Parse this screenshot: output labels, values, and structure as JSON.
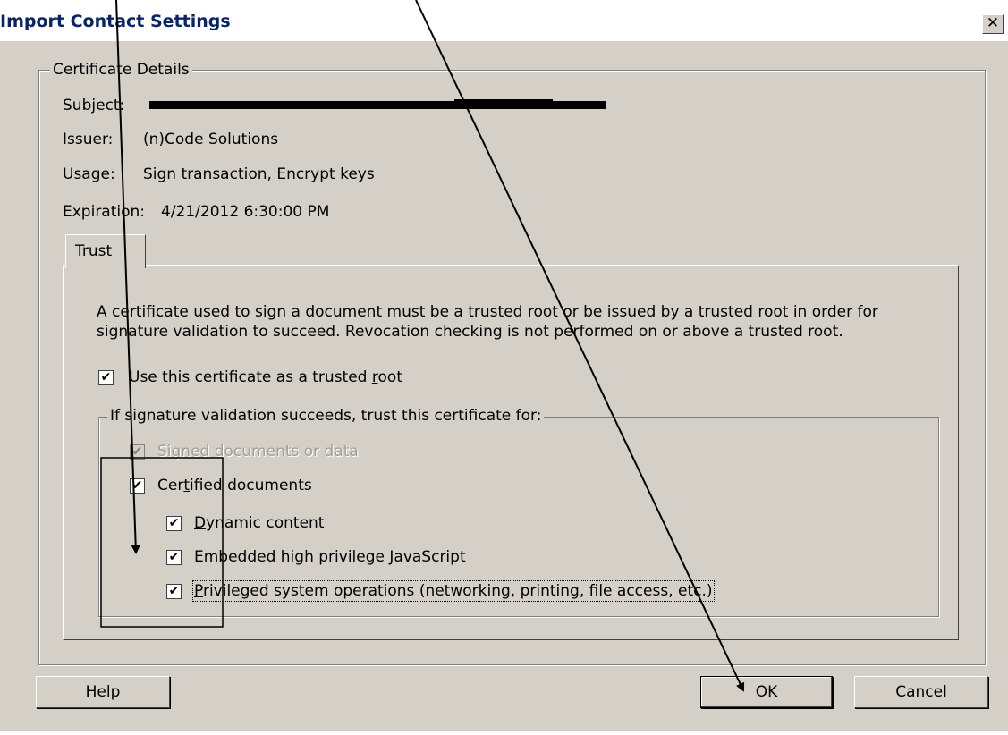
{
  "window": {
    "title": "Import Contact Settings",
    "close_label": "✕"
  },
  "certificate": {
    "group_label": "Certificate Details",
    "subject_label": "Subject:",
    "issuer_label": "Issuer:",
    "issuer_value": "(n)Code Solutions",
    "usage_label": "Usage:",
    "usage_value": "Sign transaction, Encrypt keys",
    "expiration_label": "Expiration:",
    "expiration_value": "4/21/2012 6:30:00 PM"
  },
  "tabs": [
    {
      "label": "Trust",
      "selected": true
    }
  ],
  "trust": {
    "description": "A certificate used to sign a document must be a trusted root or be issued by a trusted root in order for signature validation to succeed.  Revocation checking is not performed on or above a trusted root.",
    "trusted_root": {
      "label_pre": "Use this certificate as a trusted ",
      "label_key": "r",
      "label_post": "oot",
      "checked": true
    },
    "group_label": "If signature validation succeeds, trust this certificate for:",
    "signed_docs": {
      "label": "Signed documents or data",
      "checked": true,
      "enabled": false
    },
    "certified_docs": {
      "label_pre": "Cer",
      "label_key": "t",
      "label_post": "ified documents",
      "checked": true
    },
    "dynamic": {
      "label_pre": "",
      "label_key": "D",
      "label_post": "ynamic content",
      "checked": true
    },
    "javascript": {
      "label_pre": "Embedded high privilege ",
      "label_key": "J",
      "label_post": "avaScript",
      "checked": true
    },
    "privileged": {
      "label_pre": "",
      "label_key": "P",
      "label_post": "rivileged system operations (networking, printing, file access, etc.)",
      "checked": true
    }
  },
  "buttons": {
    "help": "Help",
    "ok": "OK",
    "cancel": "Cancel"
  },
  "check_glyph": "✔",
  "colors": {
    "dialog_bg": "#d4d0c8",
    "title_text": "#0a246a",
    "annotation": "#000000"
  }
}
